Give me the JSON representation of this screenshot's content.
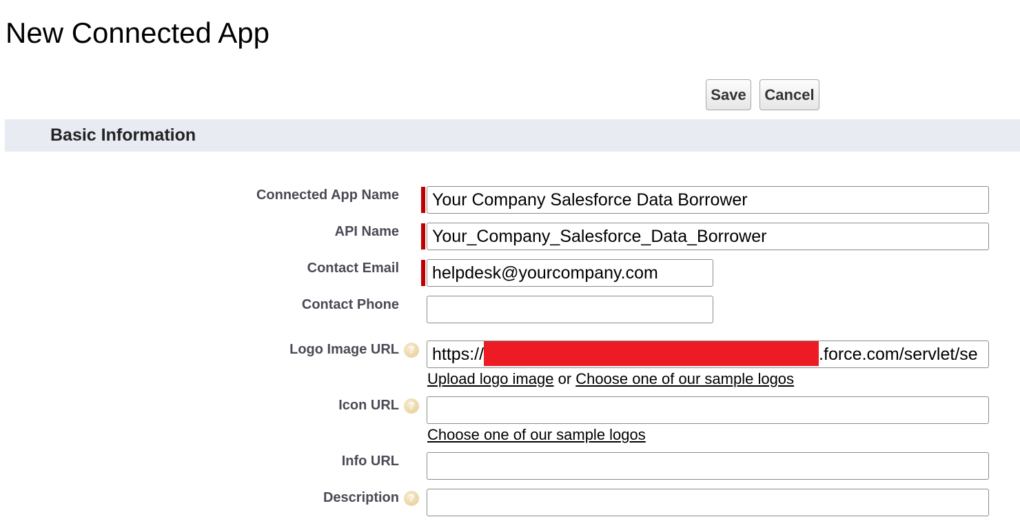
{
  "page": {
    "title": "New Connected App"
  },
  "toolbar": {
    "save_label": "Save",
    "cancel_label": "Cancel"
  },
  "section": {
    "title": "Basic Information"
  },
  "fields": {
    "connected_app_name": {
      "label": "Connected App Name",
      "value": "Your Company Salesforce Data Borrower",
      "required": true
    },
    "api_name": {
      "label": "API Name",
      "value": "Your_Company_Salesforce_Data_Borrower",
      "required": true
    },
    "contact_email": {
      "label": "Contact Email",
      "value": "helpdesk@yourcompany.com",
      "required": true
    },
    "contact_phone": {
      "label": "Contact Phone",
      "value": ""
    },
    "logo_image_url": {
      "label": "Logo Image URL",
      "value_prefix": "https://",
      "value_suffix": ".force.com/servlet/se",
      "has_help": true
    },
    "icon_url": {
      "label": "Icon URL",
      "value": "",
      "has_help": true
    },
    "info_url": {
      "label": "Info URL",
      "value": ""
    },
    "description": {
      "label": "Description",
      "value": "",
      "has_help": true
    }
  },
  "links": {
    "upload_logo": "Upload logo image",
    "or_text": "or",
    "choose_sample_logos": "Choose one of our sample logos",
    "choose_sample_icons": "Choose one of our sample logos"
  },
  "colors": {
    "required_bar": "#c00000",
    "section_bg": "#e8ebf2",
    "redaction": "#ed1c24",
    "help_icon": "#e6c98f"
  },
  "icons": {
    "help": "help-icon"
  }
}
